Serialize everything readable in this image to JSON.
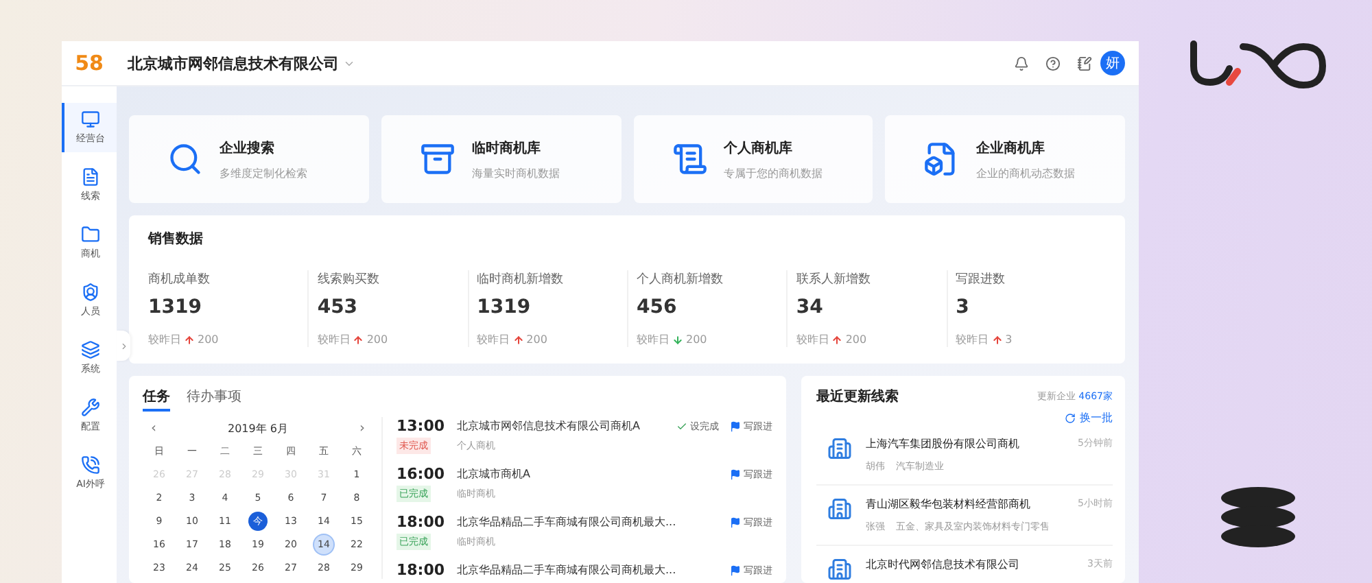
{
  "header": {
    "logo": "58",
    "company": "北京城市网邻信息技术有限公司",
    "avatar": "妍"
  },
  "sidebar": {
    "items": [
      {
        "label": "经营台",
        "selected": true
      },
      {
        "label": "线索",
        "selected": false
      },
      {
        "label": "商机",
        "selected": false
      },
      {
        "label": "人员",
        "selected": false
      },
      {
        "label": "系统",
        "selected": false
      },
      {
        "label": "配置",
        "selected": false
      },
      {
        "label": "AI外呼",
        "selected": false
      }
    ]
  },
  "quick_cards": [
    {
      "title": "企业搜索",
      "subtitle": "多维度定制化检索"
    },
    {
      "title": "临时商机库",
      "subtitle": "海量实时商机数据"
    },
    {
      "title": "个人商机库",
      "subtitle": "专属于您的商机数据"
    },
    {
      "title": "企业商机库",
      "subtitle": "企业的商机动态数据"
    }
  ],
  "sales": {
    "title": "销售数据",
    "stats": [
      {
        "label": "商机成单数",
        "value": "1319",
        "compare": "较昨日",
        "up": true,
        "delta": "200"
      },
      {
        "label": "线索购买数",
        "value": "453",
        "compare": "较昨日",
        "up": true,
        "delta": "200"
      },
      {
        "label": "临时商机新增数",
        "value": "1319",
        "compare": "较昨日",
        "up": true,
        "delta": "200"
      },
      {
        "label": "个人商机新增数",
        "value": "456",
        "compare": "较昨日",
        "up": false,
        "delta": "200"
      },
      {
        "label": "联系人新增数",
        "value": "34",
        "compare": "较昨日",
        "up": true,
        "delta": "200"
      },
      {
        "label": "写跟进数",
        "value": "3",
        "compare": "较昨日",
        "up": true,
        "delta": "3"
      }
    ]
  },
  "tasks": {
    "tabs": [
      {
        "label": "任务",
        "selected": true
      },
      {
        "label": "待办事项",
        "selected": false
      }
    ],
    "calendar": {
      "prev": "‹",
      "month": "2019年 6月",
      "next": "›",
      "weekdays": [
        "日",
        "一",
        "二",
        "三",
        "四",
        "五",
        "六"
      ],
      "days": [
        {
          "label": "26",
          "muted": true,
          "today": false,
          "selected": false
        },
        {
          "label": "27",
          "muted": true,
          "today": false,
          "selected": false
        },
        {
          "label": "28",
          "muted": true,
          "today": false,
          "selected": false
        },
        {
          "label": "29",
          "muted": true,
          "today": false,
          "selected": false
        },
        {
          "label": "30",
          "muted": true,
          "today": false,
          "selected": false
        },
        {
          "label": "31",
          "muted": true,
          "today": false,
          "selected": false
        },
        {
          "label": "1",
          "muted": false,
          "today": false,
          "selected": false
        },
        {
          "label": "2",
          "muted": false,
          "today": false,
          "selected": false
        },
        {
          "label": "3",
          "muted": false,
          "today": false,
          "selected": false
        },
        {
          "label": "4",
          "muted": false,
          "today": false,
          "selected": false
        },
        {
          "label": "5",
          "muted": false,
          "today": false,
          "selected": false
        },
        {
          "label": "6",
          "muted": false,
          "today": false,
          "selected": false
        },
        {
          "label": "7",
          "muted": false,
          "today": false,
          "selected": false
        },
        {
          "label": "8",
          "muted": false,
          "today": false,
          "selected": false
        },
        {
          "label": "9",
          "muted": false,
          "today": false,
          "selected": false
        },
        {
          "label": "10",
          "muted": false,
          "today": false,
          "selected": false
        },
        {
          "label": "11",
          "muted": false,
          "today": false,
          "selected": false
        },
        {
          "label": "今",
          "muted": false,
          "today": true,
          "selected": false
        },
        {
          "label": "13",
          "muted": false,
          "today": false,
          "selected": false
        },
        {
          "label": "14",
          "muted": false,
          "today": false,
          "selected": false
        },
        {
          "label": "15",
          "muted": false,
          "today": false,
          "selected": false
        },
        {
          "label": "16",
          "muted": false,
          "today": false,
          "selected": false
        },
        {
          "label": "17",
          "muted": false,
          "today": false,
          "selected": false
        },
        {
          "label": "18",
          "muted": false,
          "today": false,
          "selected": false
        },
        {
          "label": "19",
          "muted": false,
          "today": false,
          "selected": false
        },
        {
          "label": "20",
          "muted": false,
          "today": false,
          "selected": false
        },
        {
          "label": "14",
          "muted": false,
          "today": false,
          "selected": true
        },
        {
          "label": "22",
          "muted": false,
          "today": false,
          "selected": false
        },
        {
          "label": "23",
          "muted": false,
          "today": false,
          "selected": false
        },
        {
          "label": "24",
          "muted": false,
          "today": false,
          "selected": false
        },
        {
          "label": "25",
          "muted": false,
          "today": false,
          "selected": false
        },
        {
          "label": "26",
          "muted": false,
          "today": false,
          "selected": false
        },
        {
          "label": "27",
          "muted": false,
          "today": false,
          "selected": false
        },
        {
          "label": "28",
          "muted": false,
          "today": false,
          "selected": false
        },
        {
          "label": "29",
          "muted": false,
          "today": false,
          "selected": false
        }
      ]
    },
    "items": [
      {
        "time": "13:00",
        "title": "北京城市网邻信息技术有限公司商机A",
        "done": false,
        "tag": "未完成",
        "type": "个人商机",
        "complete_action": "设完成",
        "follow_action": "写跟进"
      },
      {
        "time": "16:00",
        "title": "北京城市商机A",
        "done": true,
        "tag": "已完成",
        "type": "临时商机",
        "follow_action": "写跟进"
      },
      {
        "time": "18:00",
        "title": "北京华品精品二手车商城有限公司商机最大...",
        "done": true,
        "tag": "已完成",
        "type": "临时商机",
        "follow_action": "写跟进"
      },
      {
        "time": "18:00",
        "title": "北京华品精品二手车商城有限公司商机最大...",
        "follow_action": "写跟进"
      }
    ]
  },
  "leads": {
    "title": "最近更新线索",
    "summary_label": "更新企业",
    "summary_count": "4667家",
    "refresh": "换一批",
    "items": [
      {
        "title": "上海汽车集团股份有限公司商机",
        "time": "5分钟前",
        "person": "胡伟",
        "industry": "汽车制造业"
      },
      {
        "title": "青山湖区毅华包装材料经营部商机",
        "time": "5小时前",
        "person": "张强",
        "industry": "五金、家具及室内装饰材料专门零售"
      },
      {
        "title": "北京时代网邻信息技术有限公司",
        "time": "3天前"
      }
    ]
  }
}
